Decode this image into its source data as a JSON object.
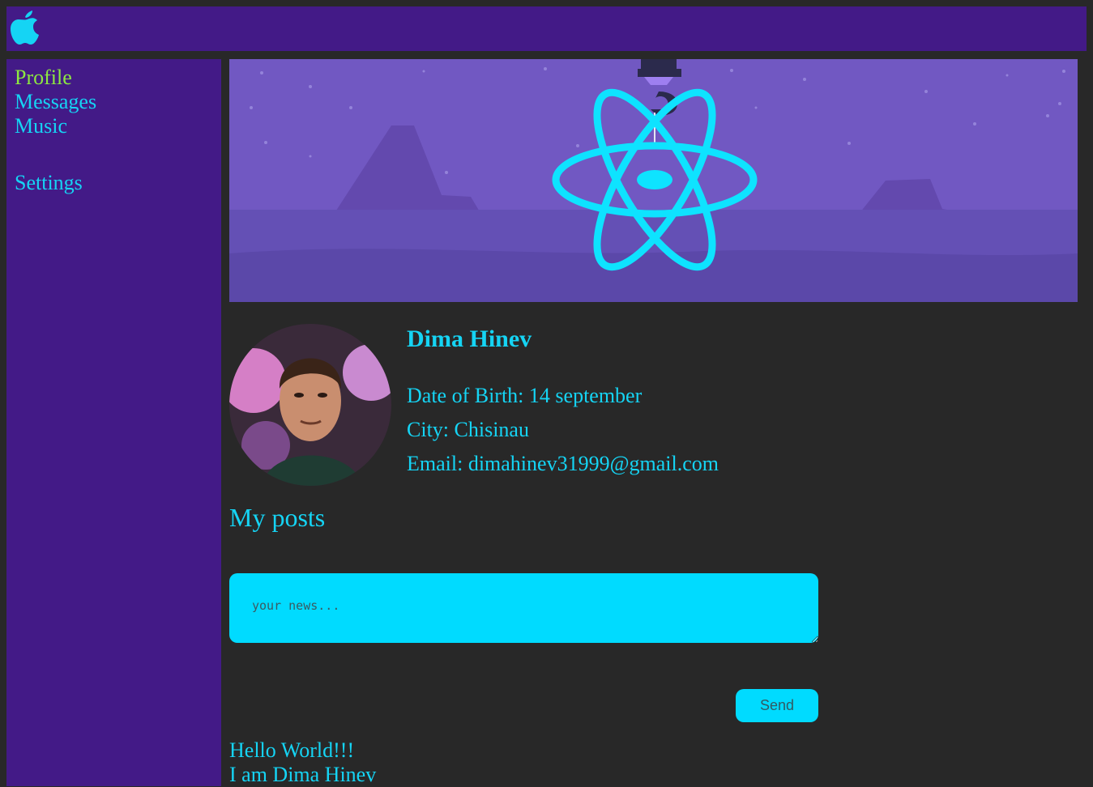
{
  "header": {
    "logo_icon": "apple-logo-icon"
  },
  "nav": {
    "items": [
      {
        "label": "Profile",
        "active": true
      },
      {
        "label": "Messages",
        "active": false
      },
      {
        "label": "Music",
        "active": false
      },
      {
        "label": "Settings",
        "active": false
      }
    ]
  },
  "banner": {
    "image": "react-logo-on-crane-hook-banner"
  },
  "profile": {
    "avatar": "profile-photo",
    "name": "Dima Hinev",
    "birth": "Date of Birth: 14 september",
    "city": "City: Chisinau",
    "email": "Email: dimahinev31999@gmail.com"
  },
  "posts": {
    "title": "My posts",
    "input_placeholder": "your news...",
    "send_label": "Send",
    "items": [
      "Hello World!!!",
      "I am Dima Hinev"
    ]
  },
  "colors": {
    "background": "#282828",
    "panel": "#431a87",
    "link": "#15d4f4",
    "active_link": "#8de840",
    "input": "#00dbff"
  }
}
